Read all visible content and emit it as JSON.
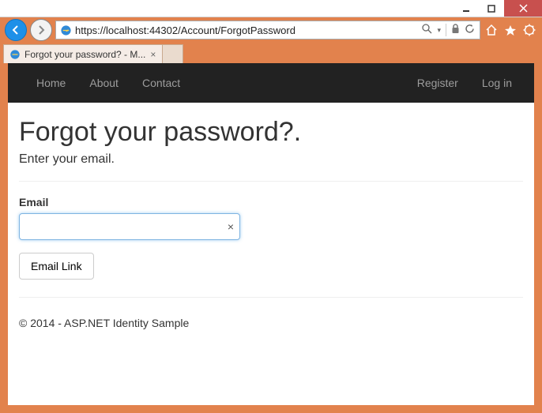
{
  "window": {
    "url": "https://localhost:44302/Account/ForgotPassword",
    "tab_title": "Forgot your password? - M..."
  },
  "navbar": {
    "left": [
      "Home",
      "About",
      "Contact"
    ],
    "right": [
      "Register",
      "Log in"
    ]
  },
  "page": {
    "heading": "Forgot your password?.",
    "subtitle": "Enter your email.",
    "email_label": "Email",
    "email_value": "",
    "submit_label": "Email Link",
    "footer": "© 2014 - ASP.NET Identity Sample"
  }
}
